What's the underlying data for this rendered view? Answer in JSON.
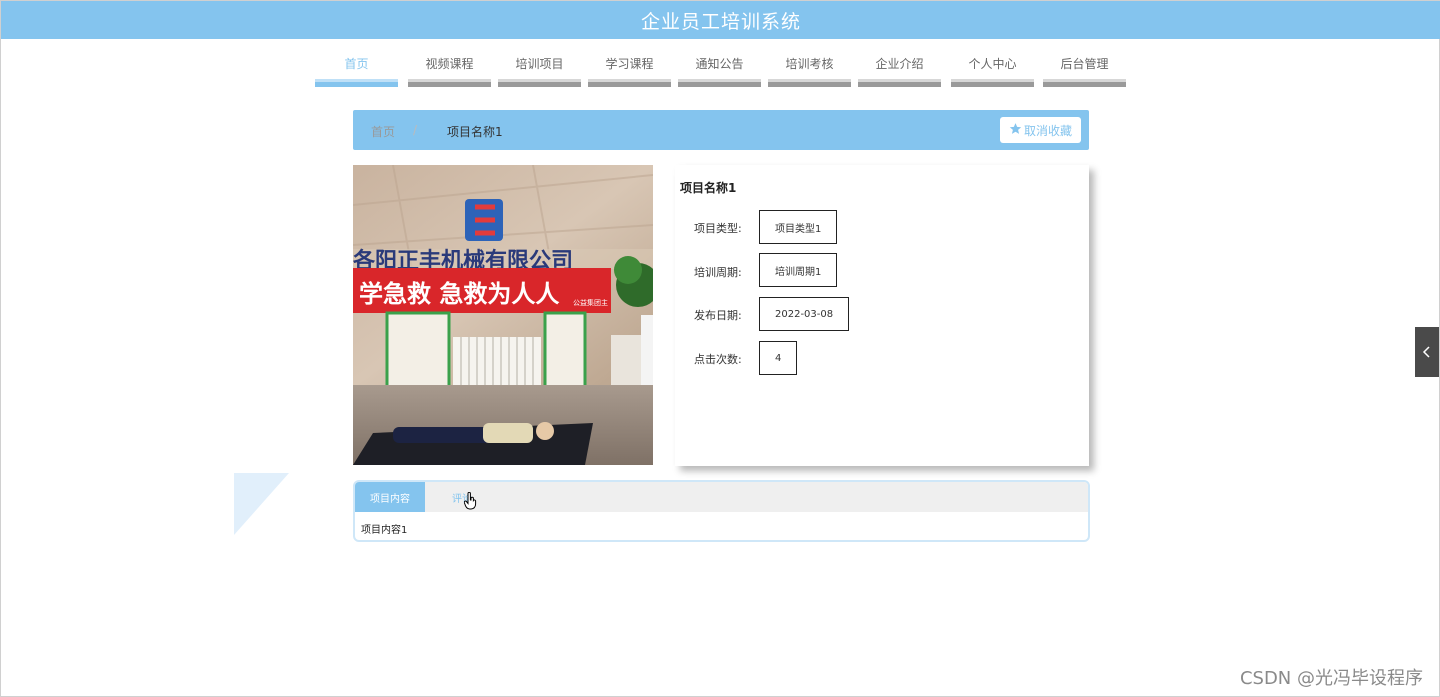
{
  "header": {
    "title": "企业员工培训系统"
  },
  "nav": {
    "items": [
      {
        "label": "首页",
        "active": true
      },
      {
        "label": "视频课程"
      },
      {
        "label": "培训项目"
      },
      {
        "label": "学习课程"
      },
      {
        "label": "通知公告"
      },
      {
        "label": "培训考核"
      },
      {
        "label": "企业介绍"
      },
      {
        "label": "个人中心"
      },
      {
        "label": "后台管理"
      }
    ]
  },
  "breadcrumb": {
    "home": "首页",
    "separator": "/",
    "current": "项目名称1"
  },
  "favorite": {
    "label": "取消收藏",
    "icon": "star-icon"
  },
  "photo": {
    "banner_text": "学急救  急救为人人",
    "company_text": "各阳正丰机械有限公司",
    "small_text": "公益集团主"
  },
  "detail": {
    "name": "项目名称1",
    "fields": [
      {
        "label": "项目类型:",
        "value": "项目类型1"
      },
      {
        "label": "培训周期:",
        "value": "培训周期1"
      },
      {
        "label": "发布日期:",
        "value": "2022-03-08"
      },
      {
        "label": "点击次数:",
        "value": "4"
      }
    ]
  },
  "tabs": {
    "items": [
      {
        "label": "项目内容"
      },
      {
        "label": "评论"
      }
    ],
    "content": "项目内容1"
  },
  "watermark": "CSDN @光冯毕设程序",
  "colors": {
    "accent": "#84c4ee",
    "side_tab": "#4a4a4a"
  }
}
